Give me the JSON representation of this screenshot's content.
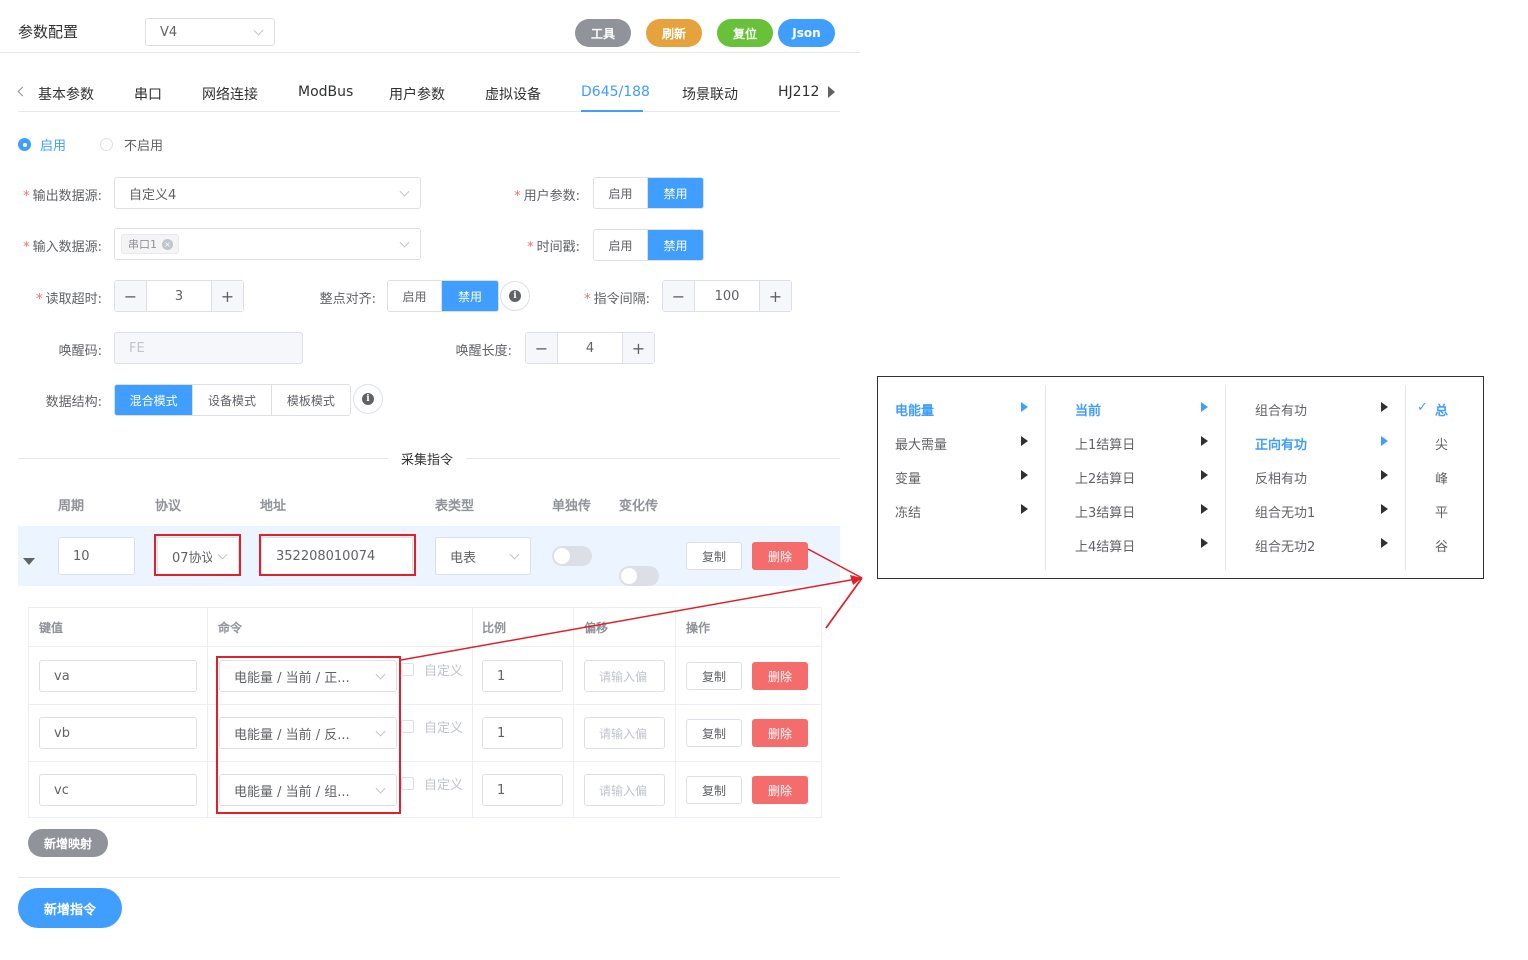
{
  "header": {
    "title": "参数配置",
    "version": "V4",
    "buttons": {
      "tools": "工具",
      "refresh": "刷新",
      "reset": "复位",
      "json": "Json"
    },
    "colors": {
      "tools": "#909399",
      "refresh": "#e6a23c",
      "reset": "#67c23a",
      "json": "#409eff"
    }
  },
  "tabs": [
    "基本参数",
    "串口",
    "网络连接",
    "ModBus",
    "用户参数",
    "虚拟设备",
    "D645/188",
    "场景联动",
    "HJ212"
  ],
  "active_tab": "D645/188",
  "enable": {
    "on": "启用",
    "off": "不启用"
  },
  "form": {
    "output_source": {
      "label": "输出数据源:",
      "value": "自定义4"
    },
    "user_params": {
      "label": "用户参数:",
      "on": "启用",
      "off": "禁用"
    },
    "input_source": {
      "label": "输入数据源:",
      "tag": "串口1"
    },
    "timestamp": {
      "label": "时间戳:",
      "on": "启用",
      "off": "禁用"
    },
    "read_timeout": {
      "label": "读取超时:",
      "value": "3"
    },
    "hour_align": {
      "label": "整点对齐:",
      "on": "启用",
      "off": "禁用"
    },
    "cmd_interval": {
      "label": "指令间隔:",
      "value": "100"
    },
    "wake_code": {
      "label": "唤醒码:",
      "value": "FE"
    },
    "wake_len": {
      "label": "唤醒长度:",
      "value": "4"
    },
    "data_struct": {
      "label": "数据结构:",
      "options": [
        "混合模式",
        "设备模式",
        "模板模式"
      ]
    }
  },
  "collect": {
    "divider": "采集指令",
    "headers": [
      "周期",
      "协议",
      "地址",
      "表类型",
      "单独传",
      "变化传"
    ],
    "row": {
      "period": "10",
      "protocol": "07协议",
      "address": "352208010074",
      "meter": "电表",
      "copy": "复制",
      "delete": "删除"
    }
  },
  "mapping": {
    "headers": [
      "键值",
      "命令",
      "比例",
      "偏移",
      "操作"
    ],
    "custom_label": "自定义",
    "offset_placeholder": "请输入偏",
    "rows": [
      {
        "key": "va",
        "cmd": "电能量 / 当前 / 正...",
        "ratio": "1"
      },
      {
        "key": "vb",
        "cmd": "电能量 / 当前 / 反...",
        "ratio": "1"
      },
      {
        "key": "vc",
        "cmd": "电能量 / 当前 / 组...",
        "ratio": "1"
      }
    ],
    "copy": "复制",
    "delete": "删除",
    "add_mapping": "新增映射"
  },
  "add_command": "新增指令",
  "cascader": {
    "col1": [
      "电能量",
      "最大需量",
      "变量",
      "冻结"
    ],
    "col2": [
      "当前",
      "上1结算日",
      "上2结算日",
      "上3结算日",
      "上4结算日"
    ],
    "col3": [
      "组合有功",
      "正向有功",
      "反相有功",
      "组合无功1",
      "组合无功2"
    ],
    "col4": [
      "总",
      "尖",
      "峰",
      "平",
      "谷"
    ]
  }
}
